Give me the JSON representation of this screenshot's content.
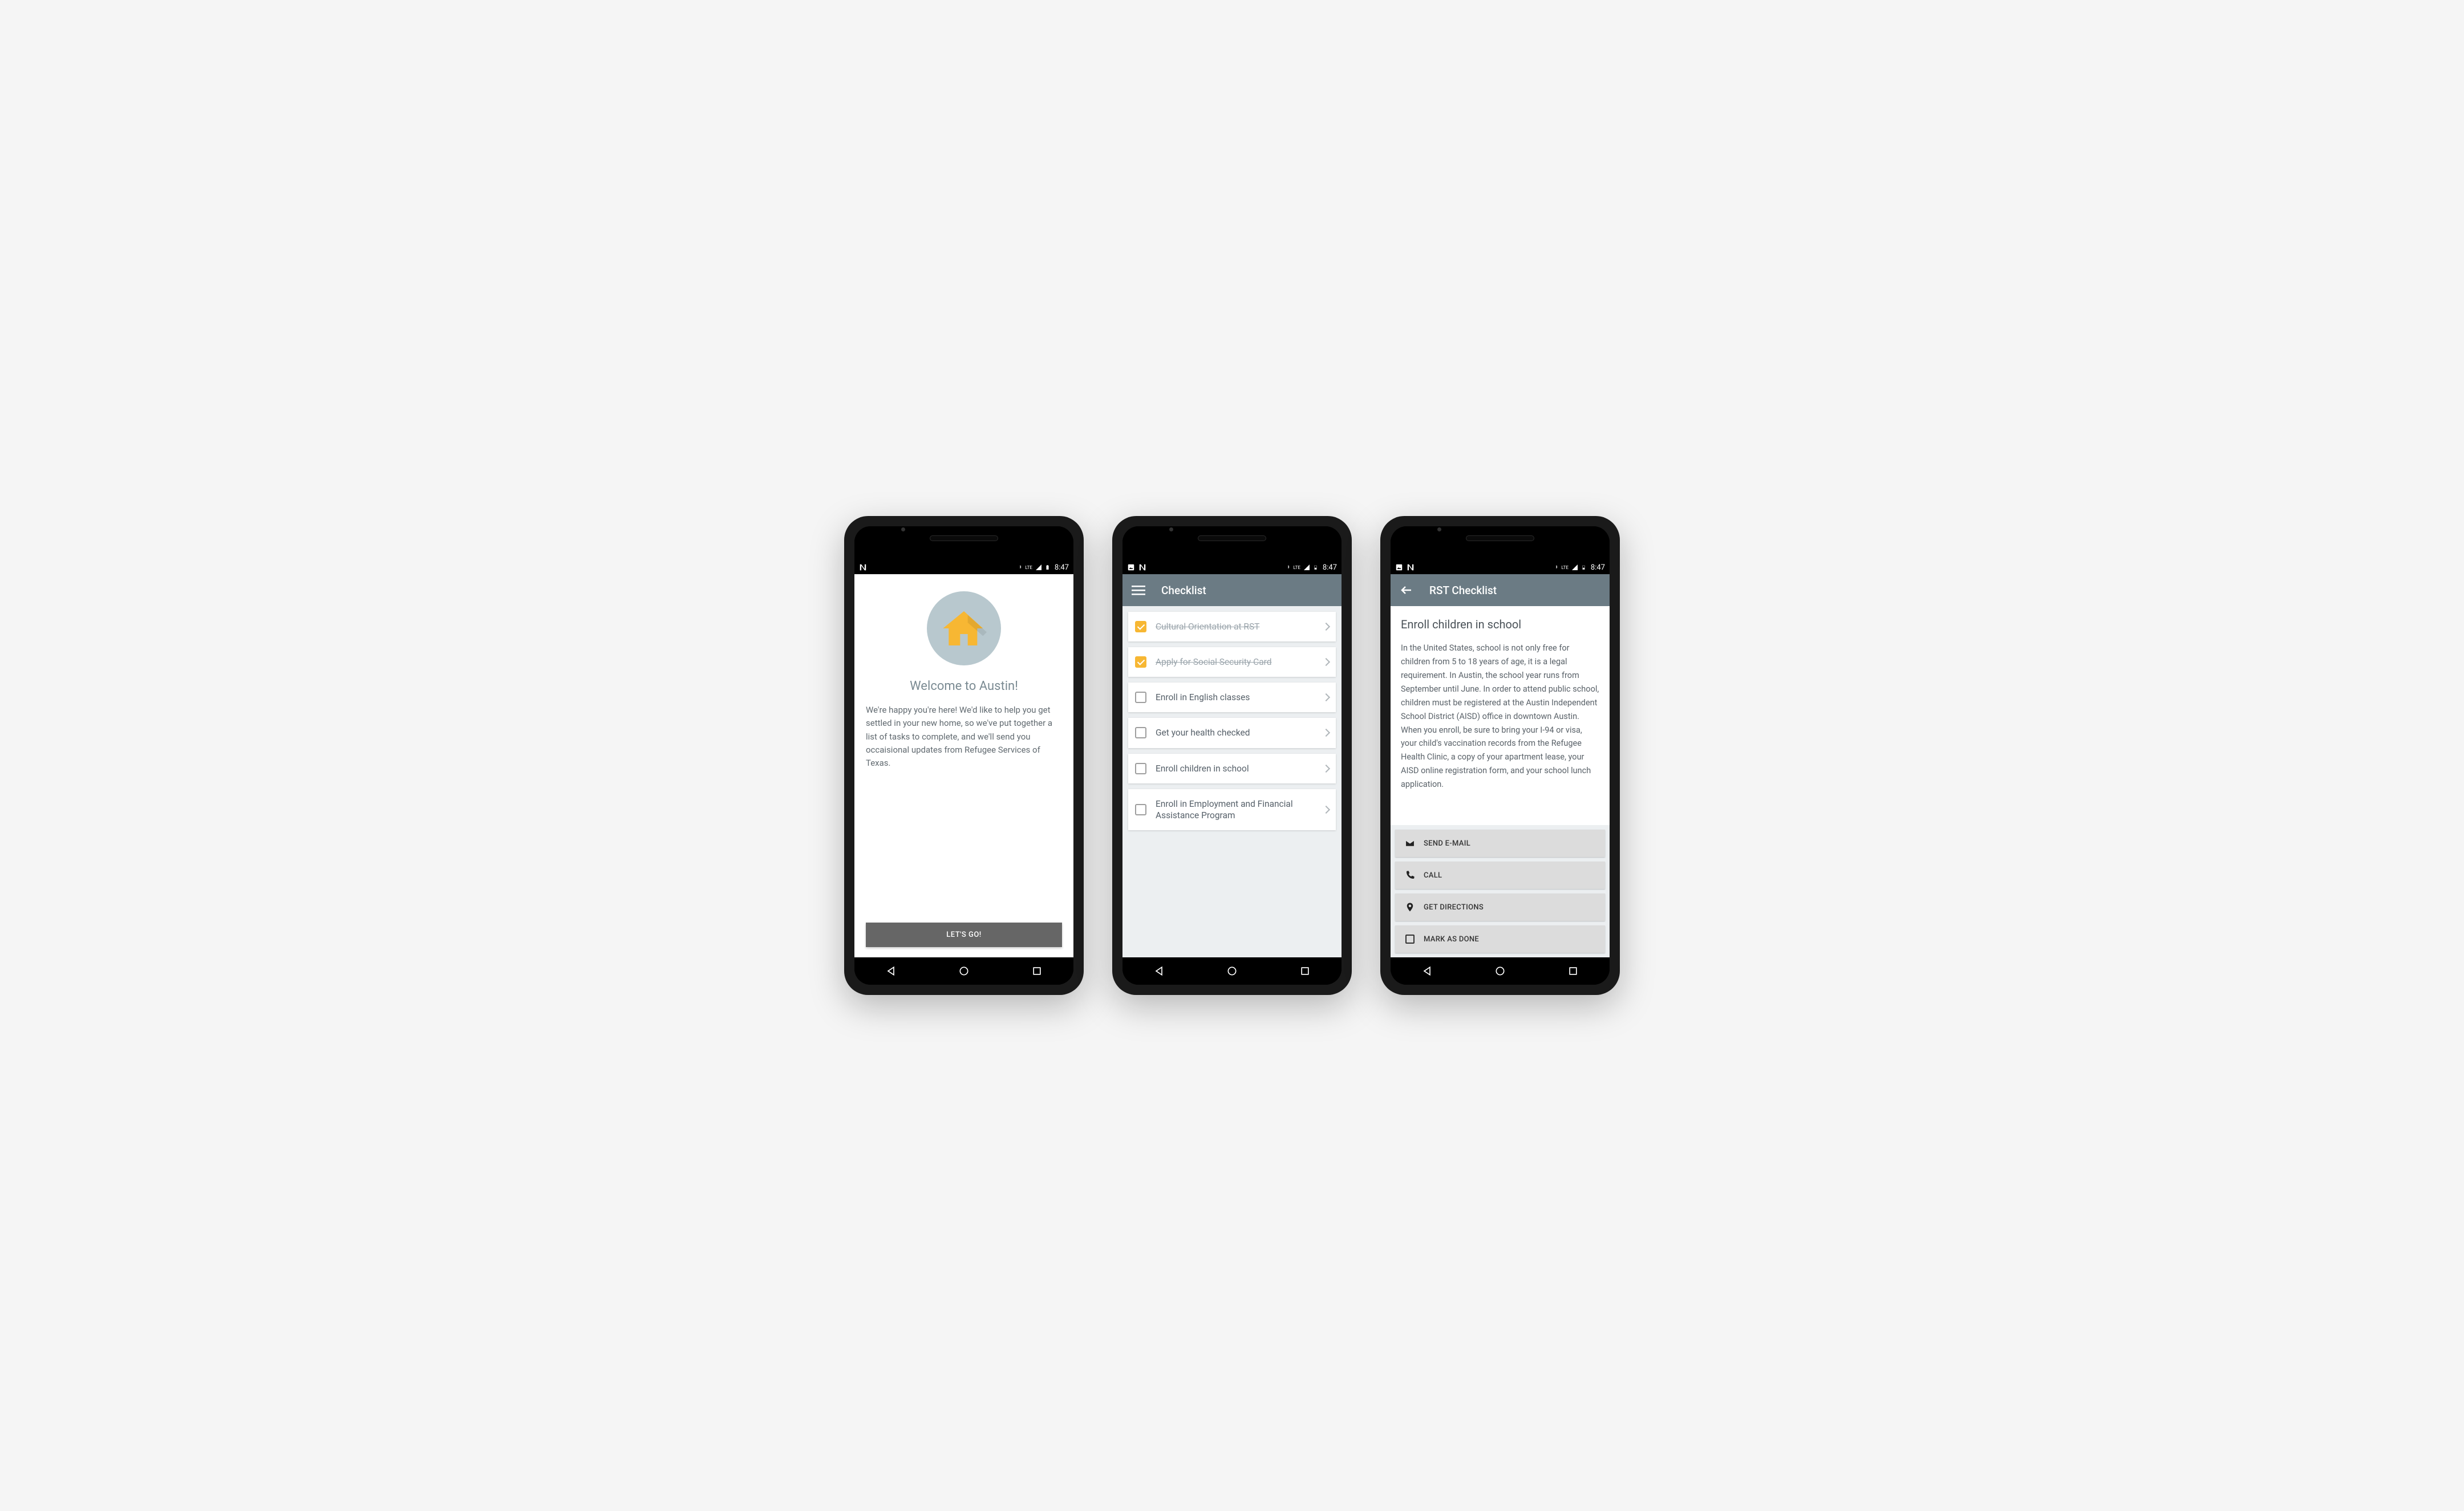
{
  "status": {
    "time": "8:47",
    "lte": "LTE"
  },
  "screen1": {
    "title": "Welcome to Austin!",
    "body": "We're happy you're here! We'd like to help you get settled in your new home, so we've put together a list of tasks to complete, and we'll send you occaisional updates from Refugee Services of Texas.",
    "button": "LET'S GO!"
  },
  "screen2": {
    "title": "Checklist",
    "items": [
      {
        "label": "Cultural Orientation at RST",
        "done": true
      },
      {
        "label": "Apply for Social Security Card",
        "done": true
      },
      {
        "label": "Enroll in English classes",
        "done": false
      },
      {
        "label": "Get your health checked",
        "done": false
      },
      {
        "label": "Enroll children in school",
        "done": false
      },
      {
        "label": "Enroll in Employment and Financial Assistance Program",
        "done": false
      }
    ]
  },
  "screen3": {
    "title": "RST Checklist",
    "heading": "Enroll children in school",
    "body": "In the United States, school is not only free for children from 5 to 18 years of age, it is a legal requirement. In Austin, the school year runs from September until June. In order to attend public school, children must be registered at the Austin Independent School District (AISD) office in downtown Austin. When you enroll, be sure to bring your I-94 or visa, your child's vaccination records from the Refugee Health Clinic, a copy of your apartment lease, your AISD online registration form, and your school lunch application.",
    "actions": {
      "email": "SEND E-MAIL",
      "call": "CALL",
      "directions": "GET DIRECTIONS",
      "done": "MARK AS DONE"
    }
  }
}
